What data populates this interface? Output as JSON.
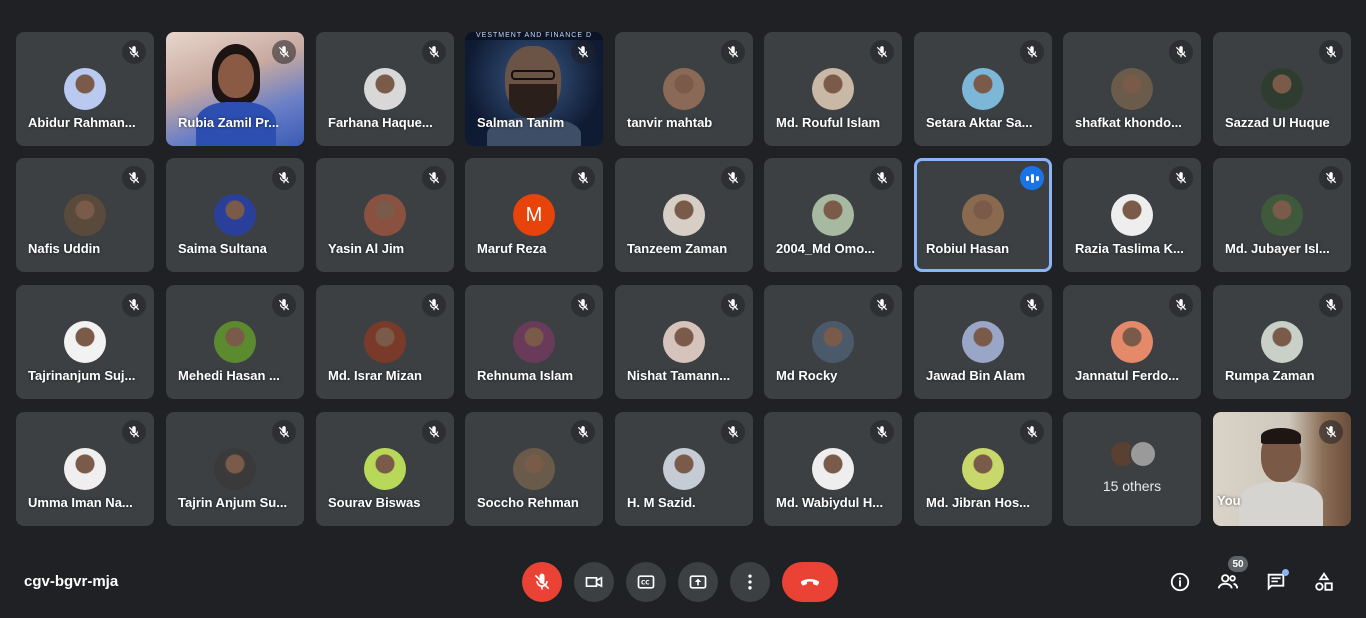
{
  "meeting": {
    "code": "cgv-bgvr-mja",
    "participants_count": "50",
    "others_label": "15 others",
    "you_label": "You",
    "video_banner_text": "VESTMENT AND FINANCE D"
  },
  "colors": {
    "background": "#202124",
    "tile": "#3c4043",
    "danger": "#ea4335",
    "speaking": "#1a73e8",
    "accent": "#8ab4f8"
  },
  "tiles": [
    {
      "name": "Abidur Rahman...",
      "kind": "avatar",
      "color": "#b9c9ef"
    },
    {
      "name": "Rubia Zamil Pr...",
      "kind": "video",
      "video": "rubia"
    },
    {
      "name": "Farhana Haque...",
      "kind": "avatar",
      "color": "#d8d8d8"
    },
    {
      "name": "Salman Tanim",
      "kind": "video",
      "video": "salman"
    },
    {
      "name": "tanvir mahtab",
      "kind": "avatar",
      "color": "#8a6a56"
    },
    {
      "name": "Md. Rouful Islam",
      "kind": "avatar",
      "color": "#c9b8a6"
    },
    {
      "name": "Setara Aktar Sa...",
      "kind": "avatar",
      "color": "#7db7d8"
    },
    {
      "name": "shafkat khondo...",
      "kind": "avatar",
      "color": "#6b5b4a"
    },
    {
      "name": "Sazzad Ul Huque",
      "kind": "avatar",
      "color": "#2f3d30"
    },
    {
      "name": "Nafis Uddin",
      "kind": "avatar",
      "color": "#5a4a3c"
    },
    {
      "name": "Saima Sultana",
      "kind": "avatar",
      "color": "#2a3f9a"
    },
    {
      "name": "Yasin Al Jim",
      "kind": "avatar",
      "color": "#8a5040"
    },
    {
      "name": "Maruf Reza",
      "kind": "letter",
      "letter": "M"
    },
    {
      "name": "Tanzeem Zaman",
      "kind": "avatar",
      "color": "#d7cfc6"
    },
    {
      "name": "2004_Md Omo...",
      "kind": "avatar",
      "color": "#a7b9a0"
    },
    {
      "name": "Robiul Hasan",
      "kind": "avatar",
      "color": "#8a6a4e",
      "speaking": true
    },
    {
      "name": "Razia Taslima K...",
      "kind": "avatar",
      "color": "#eeeeee"
    },
    {
      "name": "Md. Jubayer Isl...",
      "kind": "avatar",
      "color": "#3e5a3a"
    },
    {
      "name": "Tajrinanjum Suj...",
      "kind": "avatar",
      "color": "#f2f2f2"
    },
    {
      "name": "Mehedi Hasan ...",
      "kind": "avatar",
      "color": "#5c8a2e"
    },
    {
      "name": "Md. Israr Mizan",
      "kind": "avatar",
      "color": "#7a3a2a"
    },
    {
      "name": "Rehnuma Islam",
      "kind": "avatar",
      "color": "#6a3a5a"
    },
    {
      "name": "Nishat Tamann...",
      "kind": "avatar",
      "color": "#d6c4bc"
    },
    {
      "name": "Md Rocky",
      "kind": "avatar",
      "color": "#4a5a6a"
    },
    {
      "name": "Jawad Bin Alam",
      "kind": "avatar",
      "color": "#9aa6c8"
    },
    {
      "name": "Jannatul Ferdo...",
      "kind": "avatar",
      "color": "#e48a6a"
    },
    {
      "name": "Rumpa Zaman",
      "kind": "avatar",
      "color": "#c8d0c8"
    },
    {
      "name": "Umma Iman Na...",
      "kind": "avatar",
      "color": "#f0eeee"
    },
    {
      "name": "Tajrin Anjum Su...",
      "kind": "avatar",
      "color": "#3a3a3a"
    },
    {
      "name": "Sourav Biswas",
      "kind": "avatar",
      "color": "#b8d85a"
    },
    {
      "name": "Soccho Rehman",
      "kind": "avatar",
      "color": "#6a5a4a"
    },
    {
      "name": "H. M Sazid.",
      "kind": "avatar",
      "color": "#c6ccd6"
    },
    {
      "name": "Md. Wabiydul H...",
      "kind": "avatar",
      "color": "#eeeeee"
    },
    {
      "name": "Md. Jibran Hos...",
      "kind": "avatar",
      "color": "#c9d86a"
    },
    {
      "name": "",
      "kind": "others"
    },
    {
      "name": "",
      "kind": "video",
      "video": "you"
    }
  ],
  "controls": {
    "mic": "mic-off-icon",
    "camera": "camera-icon",
    "captions": "captions-icon",
    "present": "present-screen-icon",
    "more": "more-options-icon",
    "end": "end-call-icon",
    "info": "info-icon",
    "people": "people-icon",
    "chat": "chat-icon",
    "activities": "activities-icon"
  }
}
